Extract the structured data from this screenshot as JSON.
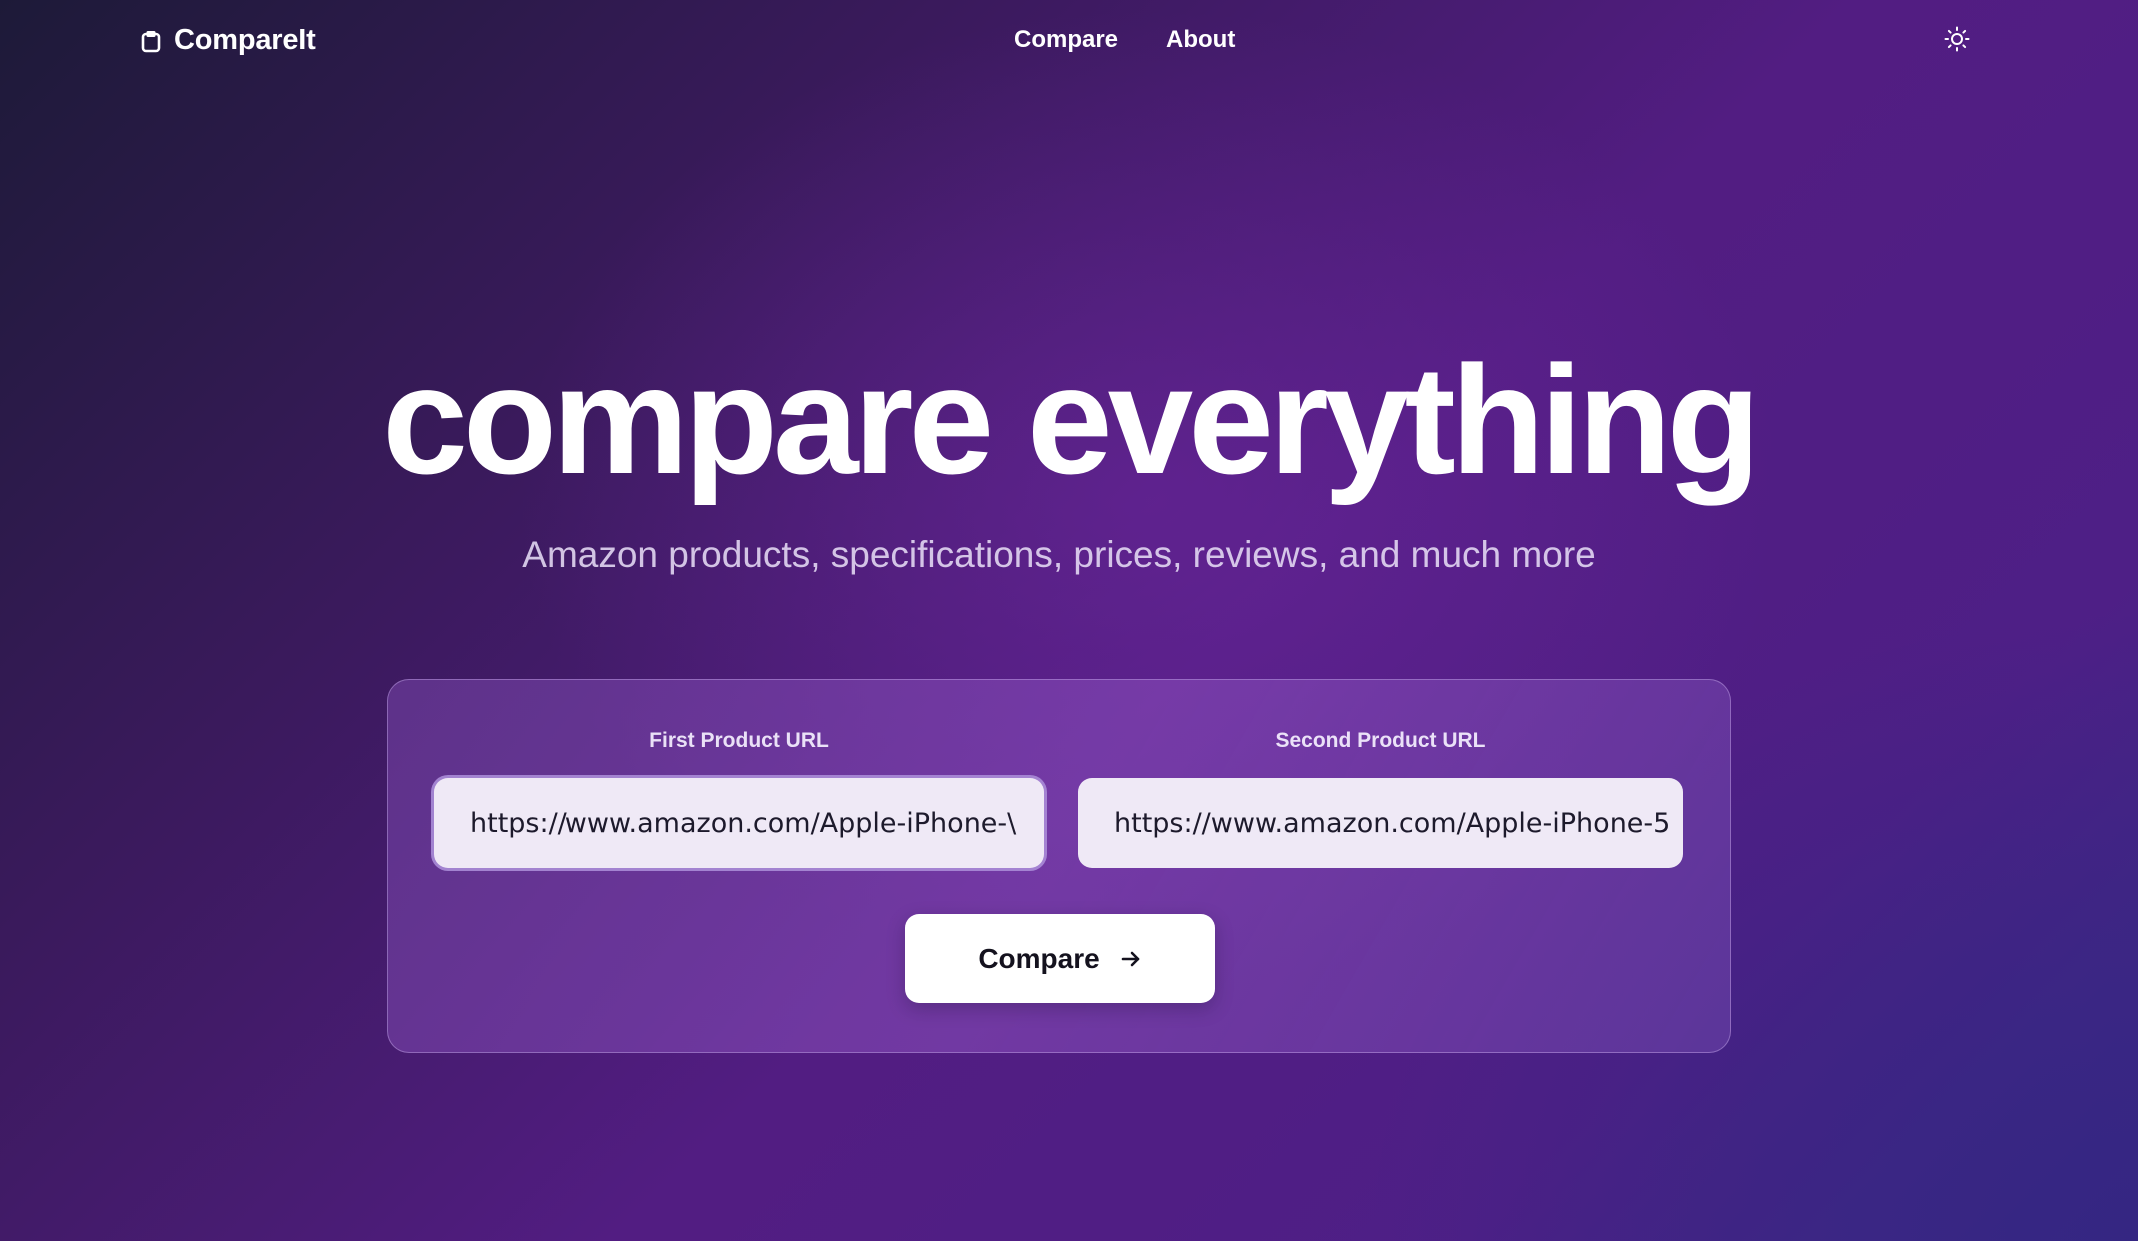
{
  "header": {
    "brand_name": "CompareIt",
    "brand_icon": "clipboard-icon",
    "nav": [
      {
        "label": "Compare"
      },
      {
        "label": "About"
      }
    ],
    "theme_toggle_icon": "sun-icon"
  },
  "hero": {
    "title": "compare everything",
    "subtitle": "Amazon products, specifications, prices, reviews, and much more"
  },
  "form": {
    "first_label": "First Product URL",
    "first_value_before_caret": "https://",
    "first_value_after_caret": "www.amazon.com/Apple-iPhone-\\",
    "second_label": "Second Product URL",
    "second_value": "https://www.amazon.com/Apple-iPhone-5",
    "submit_label": "Compare",
    "submit_icon": "arrow-right-icon"
  },
  "colors": {
    "background_start": "#1d1a38",
    "background_mid": "#521d82",
    "background_end": "#3a2a86",
    "input_background": "#efe9f6",
    "button_background": "#ffffff",
    "button_text": "#14121e"
  }
}
